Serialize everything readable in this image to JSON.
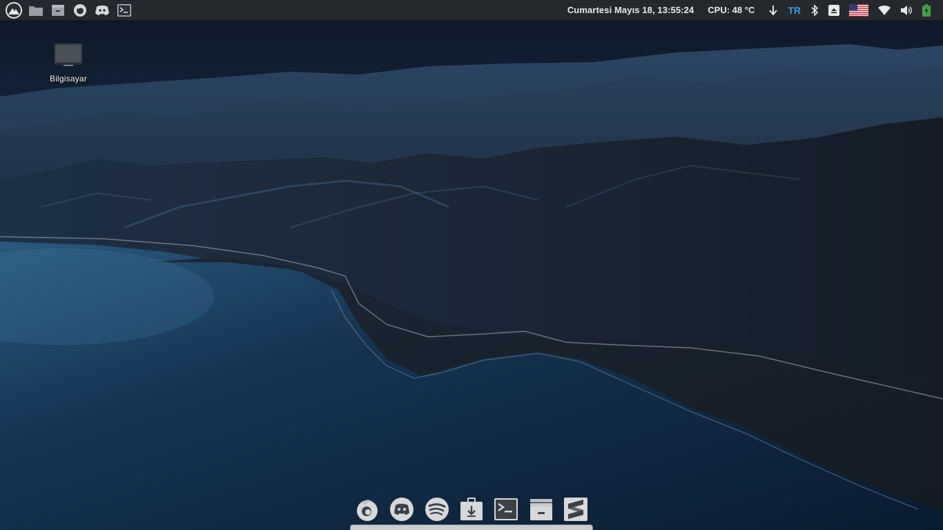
{
  "desktop": {
    "icons": [
      {
        "label": "Bilgisayar",
        "icon": "monitor-icon"
      }
    ]
  },
  "top_panel": {
    "left_launchers": [
      {
        "icon": "menu-logo-icon"
      },
      {
        "icon": "folder-icon"
      },
      {
        "icon": "file-manager-icon"
      },
      {
        "icon": "firefox-icon"
      },
      {
        "icon": "discord-icon"
      },
      {
        "icon": "terminal-icon"
      }
    ],
    "clock": "Cumartesi Mayıs 18, 13:55:24",
    "cpu": "CPU: 48 °C",
    "keyboard_layout": "TR",
    "tray": [
      "download-arrow-icon",
      "bluetooth-icon",
      "eject-icon",
      "us-flag-icon",
      "wifi-icon",
      "volume-icon",
      "battery-icon"
    ],
    "colors": {
      "panel_bg": "#25282d",
      "lang_accent": "#3d9be8",
      "battery": "#43a047"
    }
  },
  "dock": {
    "items": [
      {
        "icon": "firefox-icon"
      },
      {
        "icon": "discord-icon"
      },
      {
        "icon": "spotify-icon"
      },
      {
        "icon": "download-manager-icon"
      },
      {
        "icon": "terminal-icon"
      },
      {
        "icon": "file-manager-icon"
      },
      {
        "icon": "sublime-text-icon"
      }
    ]
  }
}
